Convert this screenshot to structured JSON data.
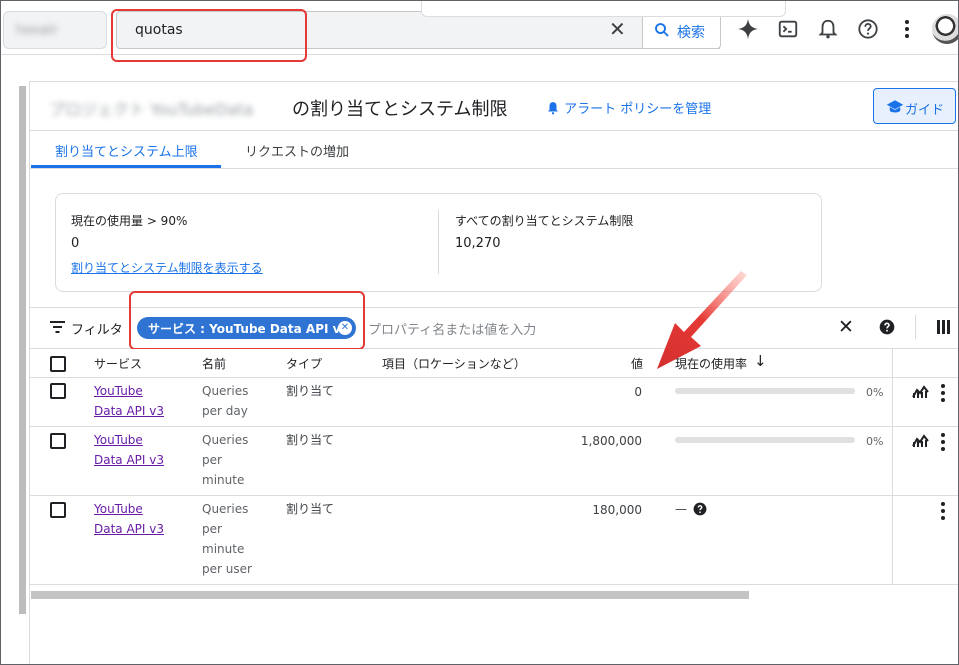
{
  "topbar": {
    "project_name": "hexatr",
    "search_value": "quotas",
    "search_button_label": "検索",
    "icons": [
      "gemini-spark-icon",
      "cloud-shell-icon",
      "notifications-icon",
      "help-icon",
      "more-vert-icon",
      "avatar"
    ]
  },
  "page": {
    "title_blurred": "プロジェクト YouTubeData",
    "title": "の割り当てとシステム制限",
    "alert_policy_link": "アラート ポリシーを管理",
    "guide_button": "ガイド"
  },
  "tabs": [
    {
      "label": "割り当てとシステム上限",
      "active": true
    },
    {
      "label": "リクエストの増加",
      "active": false
    }
  ],
  "summary": {
    "usage_label": "現在の使用量 > 90%",
    "usage_value": "0",
    "usage_link": "割り当てとシステム制限を表示する",
    "total_label": "すべての割り当てとシステム制限",
    "total_value": "10,270"
  },
  "filter": {
    "label": "フィルタ",
    "chip": "サービス : YouTube Data API v3",
    "placeholder": "プロパティ名または値を入力"
  },
  "table": {
    "headers": {
      "service": "サービス",
      "name": "名前",
      "type": "タイプ",
      "dimensions": "項目（ロケーションなど）",
      "value": "値",
      "usage": "現在の使用率"
    },
    "rows": [
      {
        "service_line1": "YouTube",
        "service_line2": "Data API v3",
        "name_lines": [
          "Queries",
          "per day"
        ],
        "type": "割り当て",
        "value": "0",
        "usage_fraction": 0,
        "usage_pct": "0%"
      },
      {
        "service_line1": "YouTube",
        "service_line2": "Data API v3",
        "name_lines": [
          "Queries",
          "per",
          "minute"
        ],
        "type": "割り当て",
        "value": "1,800,000",
        "usage_fraction": 0,
        "usage_pct": "0%"
      },
      {
        "service_line1": "YouTube",
        "service_line2": "Data API v3",
        "name_lines": [
          "Queries",
          "per",
          "minute",
          "per user"
        ],
        "type": "割り当て",
        "value": "180,000",
        "usage_text": "—"
      }
    ]
  },
  "colors": {
    "accent": "#1a73e8",
    "chip": "#2f74d3",
    "annotation_red": "#e53935",
    "visited_link": "#681da8"
  }
}
